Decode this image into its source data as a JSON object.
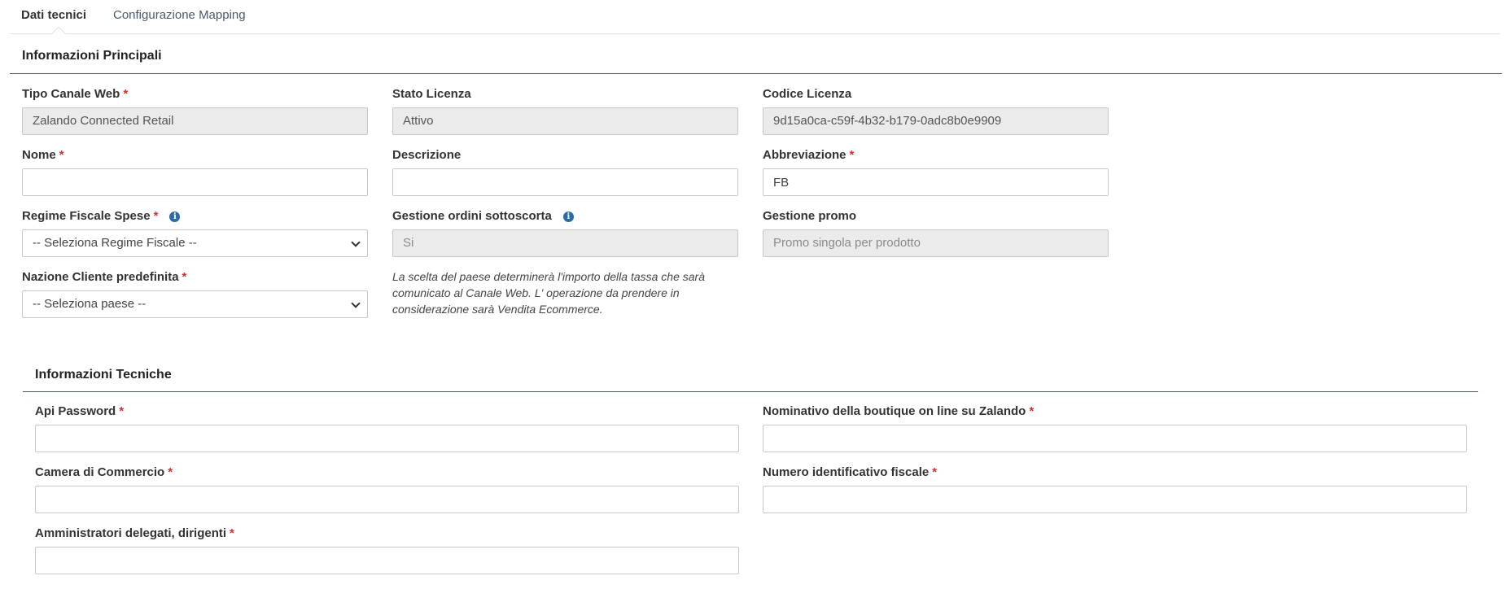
{
  "tabs": [
    {
      "label": "Dati tecnici"
    },
    {
      "label": "Configurazione Mapping"
    }
  ],
  "principali": {
    "title": "Informazioni Principali",
    "tipo_canale": {
      "label": "Tipo Canale Web",
      "value": "Zalando Connected Retail"
    },
    "stato_licenza": {
      "label": "Stato Licenza",
      "value": "Attivo"
    },
    "codice_licenza": {
      "label": "Codice Licenza",
      "value": "9d15a0ca-c59f-4b32-b179-0adc8b0e9909"
    },
    "nome": {
      "label": "Nome",
      "value": ""
    },
    "descrizione": {
      "label": "Descrizione",
      "value": ""
    },
    "abbreviazione": {
      "label": "Abbreviazione",
      "value": "FB"
    },
    "regime_fiscale": {
      "label": "Regime Fiscale Spese",
      "value": "-- Seleziona Regime Fiscale --"
    },
    "gestione_ordini": {
      "label": "Gestione ordini sottoscorta",
      "value": "Si"
    },
    "gestione_promo": {
      "label": "Gestione promo",
      "value": "Promo singola per prodotto"
    },
    "nazione": {
      "label": "Nazione Cliente predefinita",
      "value": "-- Seleziona paese --"
    },
    "note": "La scelta del paese determinerà l'importo della tassa che sarà comunicato al Canale Web. L' operazione da prendere in considerazione sarà Vendita Ecommerce."
  },
  "tecniche": {
    "title": "Informazioni Tecniche",
    "api_password": {
      "label": "Api Password",
      "value": ""
    },
    "nominativo": {
      "label": "Nominativo della boutique on line su Zalando",
      "value": ""
    },
    "camera": {
      "label": "Camera di Commercio",
      "value": ""
    },
    "numero_fiscale": {
      "label": "Numero identificativo fiscale",
      "value": ""
    },
    "amministratori": {
      "label": "Amministratori delegati, dirigenti",
      "value": ""
    }
  },
  "required_mark": "*",
  "info_glyph": "i",
  "colors": {
    "required": "#d32f2f",
    "info": "#2d6aa8",
    "rule": "#4a5a6a",
    "readonly_bg": "#ebebeb"
  }
}
